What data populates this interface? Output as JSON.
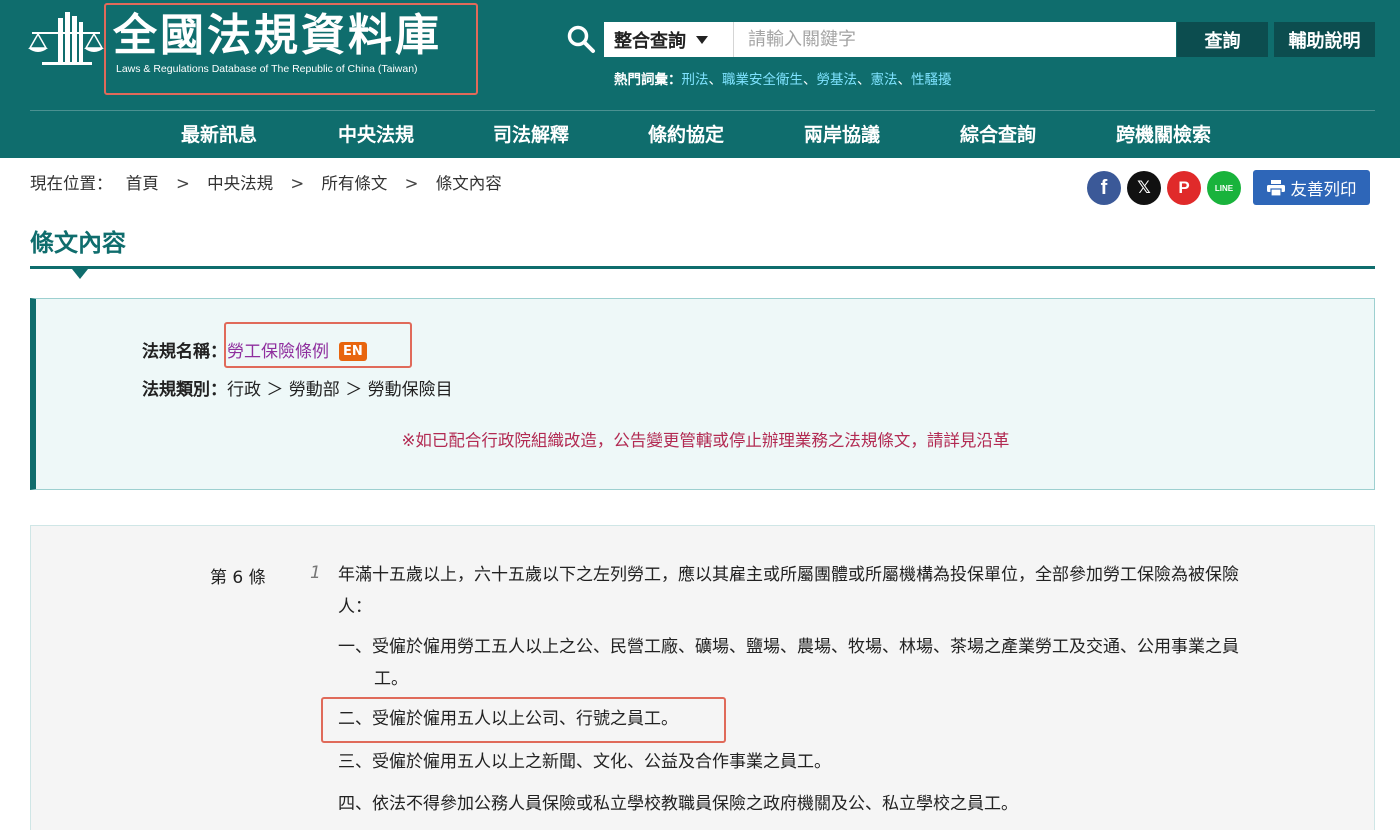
{
  "header": {
    "logo_title": "全國法規資料庫",
    "logo_subtitle": "Laws & Regulations Database of The Republic of China (Taiwan)",
    "search_scope": "整合查詢",
    "search_placeholder": "請輸入關鍵字",
    "search_button": "查詢",
    "help_button": "輔助說明",
    "hot_label": "熱門詞彙：",
    "hot_terms": [
      "刑法",
      "職業安全衛生",
      "勞基法",
      "憲法",
      "性騷擾"
    ],
    "hot_separator": "、",
    "bg_color": "#0f6d6d"
  },
  "nav": [
    "最新訊息",
    "中央法規",
    "司法解釋",
    "條約協定",
    "兩岸協議",
    "綜合查詢",
    "跨機關檢索"
  ],
  "breadcrumb": {
    "label": "現在位置：",
    "items": [
      "首頁",
      "中央法規",
      "所有條文",
      "條文內容"
    ],
    "separator": ">"
  },
  "share": {
    "facebook": {
      "glyph": "f",
      "color": "#3b5998"
    },
    "x": {
      "glyph": "𝕏",
      "color": "#111111"
    },
    "plurk": {
      "glyph": "P",
      "color": "#e02a2a"
    },
    "line": {
      "glyph": "LINE",
      "color": "#19b33c"
    },
    "print_label": "友善列印"
  },
  "page_title": "條文內容",
  "law_info": {
    "name_key": "法規名稱：",
    "name_value": "勞工保險條例",
    "en_badge": "EN",
    "category_key": "法規類別：",
    "category_value": "行政 ＞ 勞動部 ＞ 勞動保險目",
    "notice": "※如已配合行政院組織改造，公告變更管轄或停止辦理業務之法規條文，請詳見沿革"
  },
  "article": {
    "number": "第 6 條",
    "paragraph_no": "1",
    "text": "年滿十五歲以上，六十五歲以下之左列勞工，應以其雇主或所屬團體或所屬機構為投保單位，全部參加勞工保險為被保險人：",
    "items": [
      "一、受僱於僱用勞工五人以上之公、民營工廠、礦場、鹽場、農場、牧場、林場、茶場之產業勞工及交通、公用事業之員工。",
      "二、受僱於僱用五人以上公司、行號之員工。",
      "三、受僱於僱用五人以上之新聞、文化、公益及合作事業之員工。",
      "四、依法不得參加公務人員保險或私立學校教職員保險之政府機關及公、私立學校之員工。"
    ]
  }
}
